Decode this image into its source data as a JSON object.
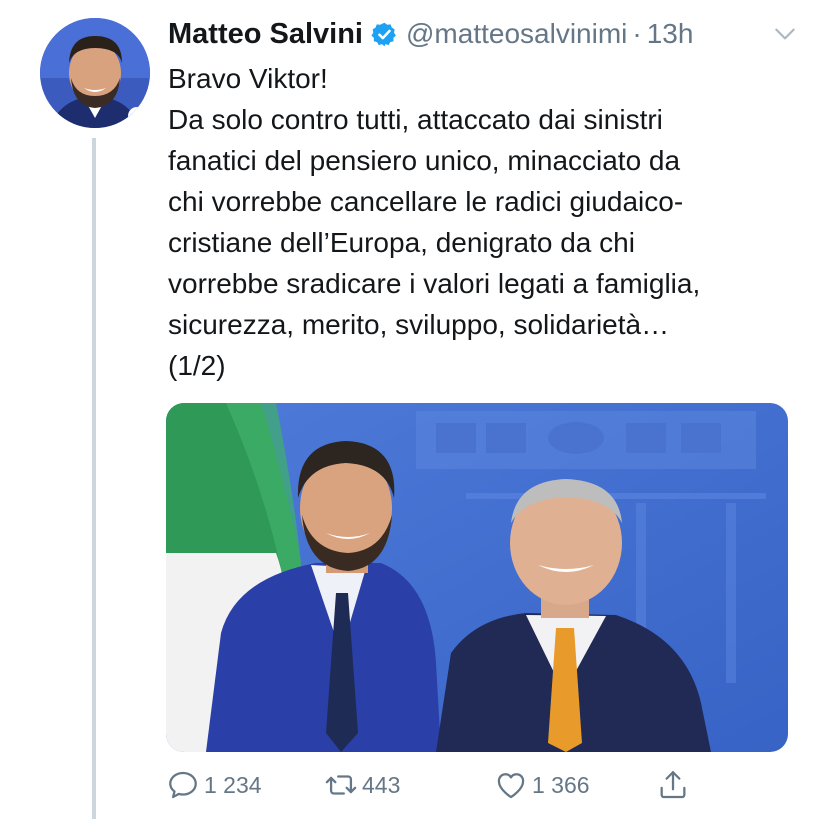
{
  "tweet": {
    "author": {
      "display_name": "Matteo Salvini",
      "handle": "@matteosalvinimi",
      "verified": true,
      "avatar_icon": "profile-photo"
    },
    "separator": "·",
    "time": "13h",
    "text_lines": [
      "Bravo Viktor!",
      "Da solo contro tutti, attaccato dai sinistri",
      "fanatici del pensiero unico, minacciato da",
      "chi vorrebbe cancellare le radici giudaico-",
      "cristiane dell’Europa, denigrato da chi",
      "vorrebbe sradicare i valori legati a famiglia,",
      "sicurezza, merito, sviluppo, solidarietà…",
      "(1/2)"
    ],
    "media": {
      "type": "photo"
    },
    "stats": {
      "replies": "1 234",
      "retweets": "443",
      "likes": "1 366"
    }
  },
  "colors": {
    "text": "#14171a",
    "secondary": "#657786",
    "verified": "#1da1f2",
    "thread_line": "#ccd6dd"
  },
  "icons": {
    "verified": "verified-badge-icon",
    "chevron": "chevron-down-icon",
    "reply": "reply-icon",
    "retweet": "retweet-icon",
    "like": "heart-icon",
    "share": "share-icon"
  }
}
